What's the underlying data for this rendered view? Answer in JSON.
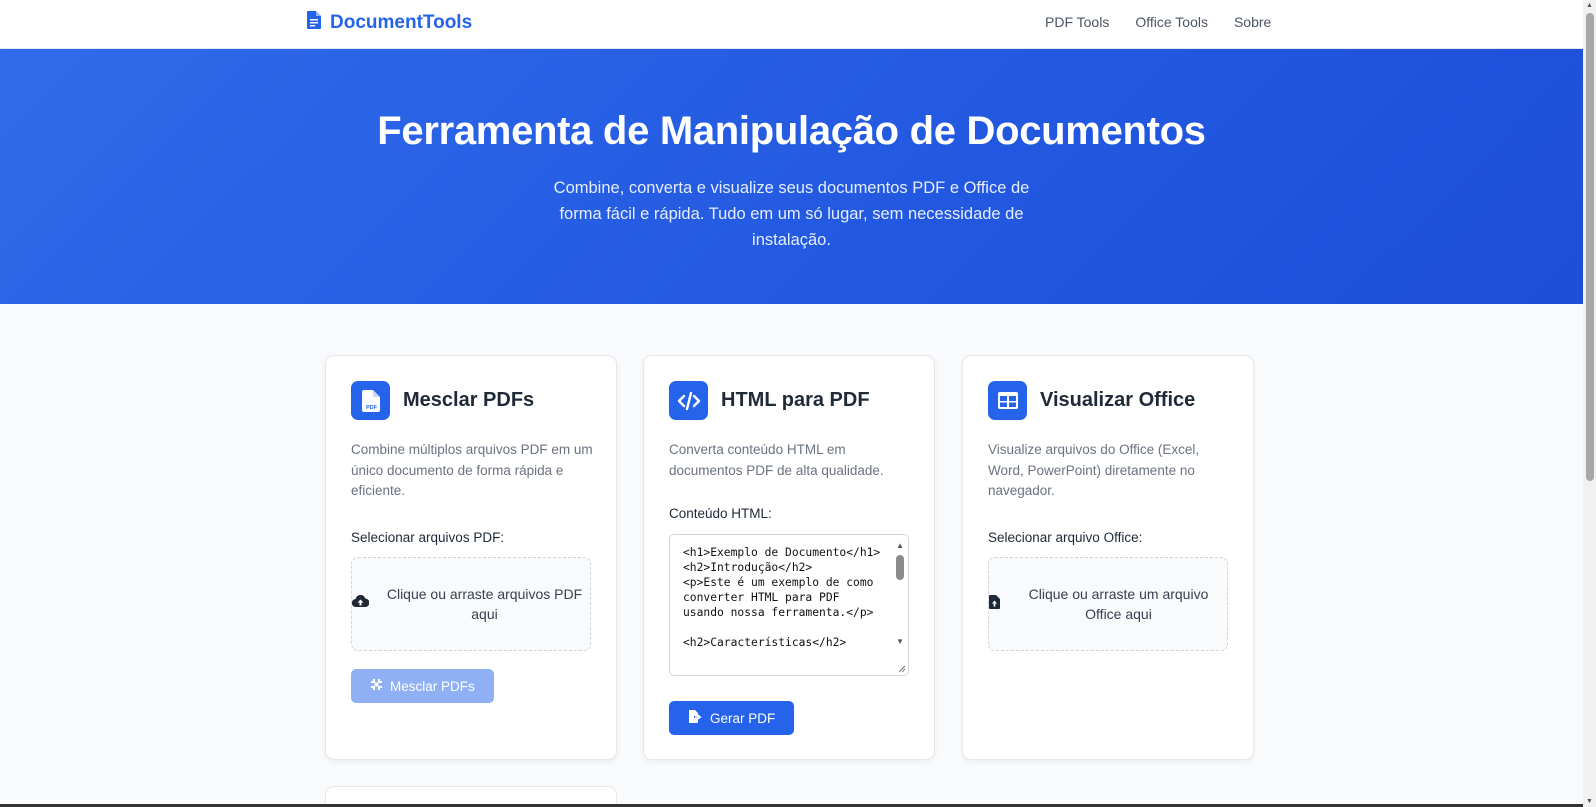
{
  "nav": {
    "brand": "DocumentTools",
    "links": [
      "PDF Tools",
      "Office Tools",
      "Sobre"
    ]
  },
  "hero": {
    "title": "Ferramenta de Manipulação de Documentos",
    "subtitle": "Combine, converta e visualize seus documentos PDF e Office de forma fácil e rápida. Tudo em um só lugar, sem necessidade de instalação."
  },
  "cards": {
    "merge": {
      "icon": "pdf-file-icon",
      "title": "Mesclar PDFs",
      "description": "Combine múltiplos arquivos PDF em um único documento de forma rápida e eficiente.",
      "field_label": "Selecionar arquivos PDF:",
      "dropzone_text": "Clique ou arraste arquivos PDF aqui",
      "button_label": "Mesclar PDFs"
    },
    "html": {
      "icon": "code-icon",
      "title": "HTML para PDF",
      "description": "Converta conteúdo HTML em documentos PDF de alta qualidade.",
      "field_label": "Conteúdo HTML:",
      "textarea_value": "<h1>Exemplo de Documento</h1>\n<h2>Introdução</h2>\n<p>Este é um exemplo de como converter HTML para PDF usando nossa ferramenta.</p>\n\n<h2>Características</h2>",
      "button_label": "Gerar PDF"
    },
    "office": {
      "icon": "table-icon",
      "title": "Visualizar Office",
      "description": "Visualize arquivos do Office (Excel, Word, PowerPoint) diretamente no navegador.",
      "field_label": "Selecionar arquivo Office:",
      "dropzone_text": "Clique ou arraste um arquivo Office aqui"
    }
  },
  "colors": {
    "primary": "#2563eb",
    "primary_disabled": "#8fb0f5",
    "hero_bg": "#2563eb"
  }
}
